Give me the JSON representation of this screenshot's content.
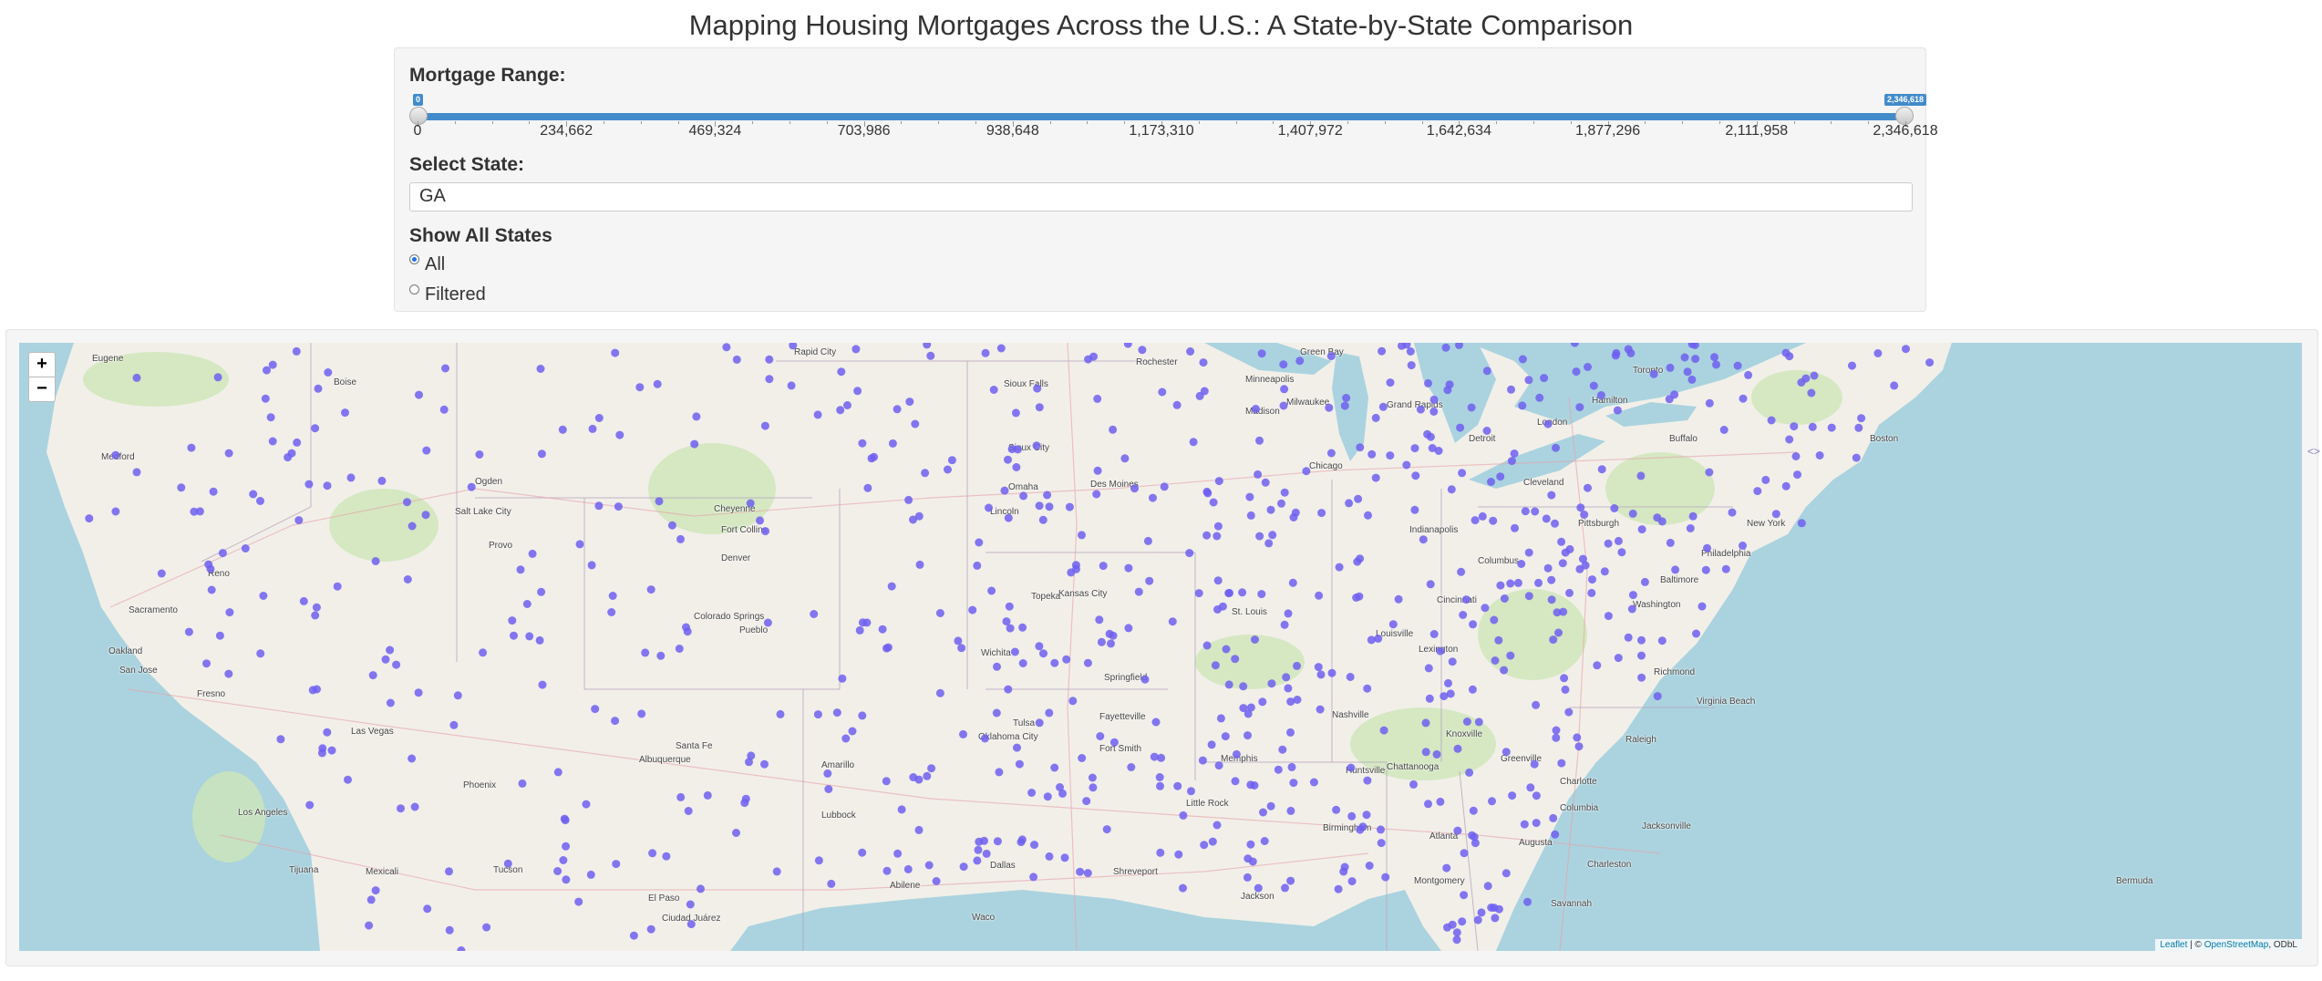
{
  "title": "Mapping Housing Mortgages Across the U.S.: A State-by-State Comparison",
  "mortgage_range": {
    "label": "Mortgage Range:",
    "min": 0,
    "max": 2346618,
    "value_low": 0,
    "value_high": 2346618,
    "value_low_label": "0",
    "value_high_label": "2,346,618",
    "ticks": [
      "0",
      "234,662",
      "469,324",
      "703,986",
      "938,648",
      "1,173,310",
      "1,407,972",
      "1,642,634",
      "1,877,296",
      "2,111,958",
      "2,346,618"
    ]
  },
  "state_select": {
    "label": "Select State:",
    "value": "GA"
  },
  "show_states": {
    "label": "Show All States",
    "options": [
      {
        "label": "All",
        "selected": true
      },
      {
        "label": "Filtered",
        "selected": false
      }
    ]
  },
  "map": {
    "zoom_in": "+",
    "zoom_out": "−",
    "attribution_leaflet": "Leaflet",
    "attribution_sep": " | © ",
    "attribution_osm": "OpenStreetMap",
    "attribution_odbl": ", ODbL",
    "marker_color": "#6f5ff0",
    "cities": {
      "c01": "Boise",
      "c02": "Salt Lake City",
      "c03": "Denver",
      "c04": "Cheyenne",
      "c05": "Sacramento",
      "c06": "Oakland",
      "c07": "San Jose",
      "c08": "Fresno",
      "c09": "Las Vegas",
      "c10": "Los Angeles",
      "c11": "Tijuana",
      "c12": "Phoenix",
      "c13": "Tucson",
      "c14": "Albuquerque",
      "c15": "Santa Fe",
      "c16": "El Paso",
      "c17": "Ciudad Juárez",
      "c18": "Colorado Springs",
      "c19": "Omaha",
      "c20": "Lincoln",
      "c21": "Des Moines",
      "c22": "Kansas City",
      "c23": "Wichita",
      "c24": "Oklahoma City",
      "c25": "Tulsa",
      "c26": "Dallas",
      "c27": "Waco",
      "c28": "Abilene",
      "c29": "Lubbock",
      "c30": "Amarillo",
      "c31": "Minneapolis",
      "c32": "Milwaukee",
      "c33": "Chicago",
      "c34": "Madison",
      "c35": "Detroit",
      "c36": "Toronto",
      "c37": "Hamilton",
      "c38": "Cleveland",
      "c39": "Columbus",
      "c40": "Cincinnati",
      "c41": "Louisville",
      "c42": "Indianapolis",
      "c43": "St. Louis",
      "c44": "Springfield",
      "c45": "Nashville",
      "c46": "Memphis",
      "c47": "Atlanta",
      "c48": "Birmingham",
      "c49": "Charlotte",
      "c50": "Raleigh",
      "c51": "Richmond",
      "c52": "Washington",
      "c53": "Baltimore",
      "c54": "Philadelphia",
      "c55": "New York",
      "c56": "Boston",
      "c57": "Pittsburgh",
      "c58": "Knoxville",
      "c59": "Jackson",
      "c60": "Shreveport",
      "c61": "Jacksonville",
      "c62": "Charleston",
      "c63": "Virginia Beach",
      "c64": "London",
      "c65": "Buffalo",
      "c66": "Rochester",
      "c67": "Sioux Falls",
      "c68": "Sioux City",
      "c69": "Rapid City",
      "c70": "Green Bay",
      "c71": "Grand Rapids",
      "c72": "Bermuda",
      "c73": "Mexicali",
      "c74": "Ogden",
      "c75": "Provo",
      "c76": "Reno",
      "c77": "Medford",
      "c78": "Eugene",
      "c79": "Fort Collins",
      "c80": "Pueblo",
      "c81": "Topeka",
      "c82": "Fort Smith",
      "c83": "Fayetteville",
      "c84": "Little Rock",
      "c85": "Chattanooga",
      "c86": "Greenville",
      "c87": "Columbia",
      "c88": "Augusta",
      "c89": "Savannah",
      "c90": "Montgomery",
      "c91": "Huntsville",
      "c92": "Lexington"
    }
  }
}
